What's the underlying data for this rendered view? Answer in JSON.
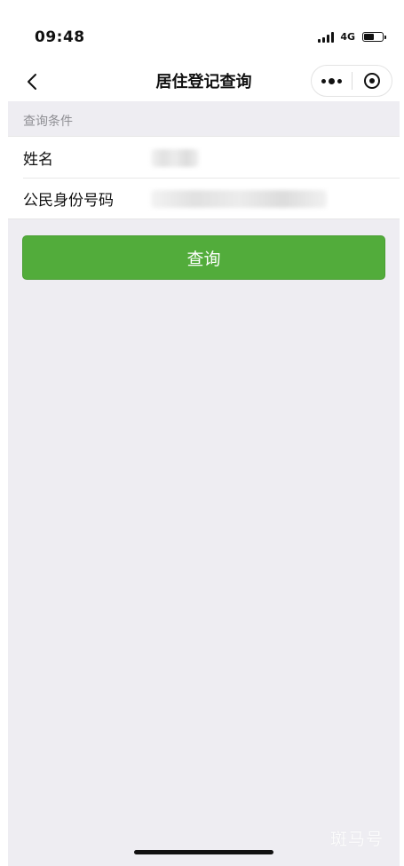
{
  "status_bar": {
    "time": "09:48",
    "network": "4G",
    "battery_level": 0.6
  },
  "nav": {
    "title": "居住登记查询",
    "back_icon": "chevron-left-icon",
    "more_icon": "more-dots-icon",
    "close_icon": "target-circle-icon"
  },
  "form": {
    "section_label": "查询条件",
    "name_label": "姓名",
    "name_value": "",
    "id_label": "公民身份号码",
    "id_value": ""
  },
  "query_button_label": "查询",
  "watermark": "斑马号",
  "colors": {
    "primary_green": "#52ac3b",
    "page_background": "#eeedf2",
    "section_text": "#8f8f94"
  }
}
